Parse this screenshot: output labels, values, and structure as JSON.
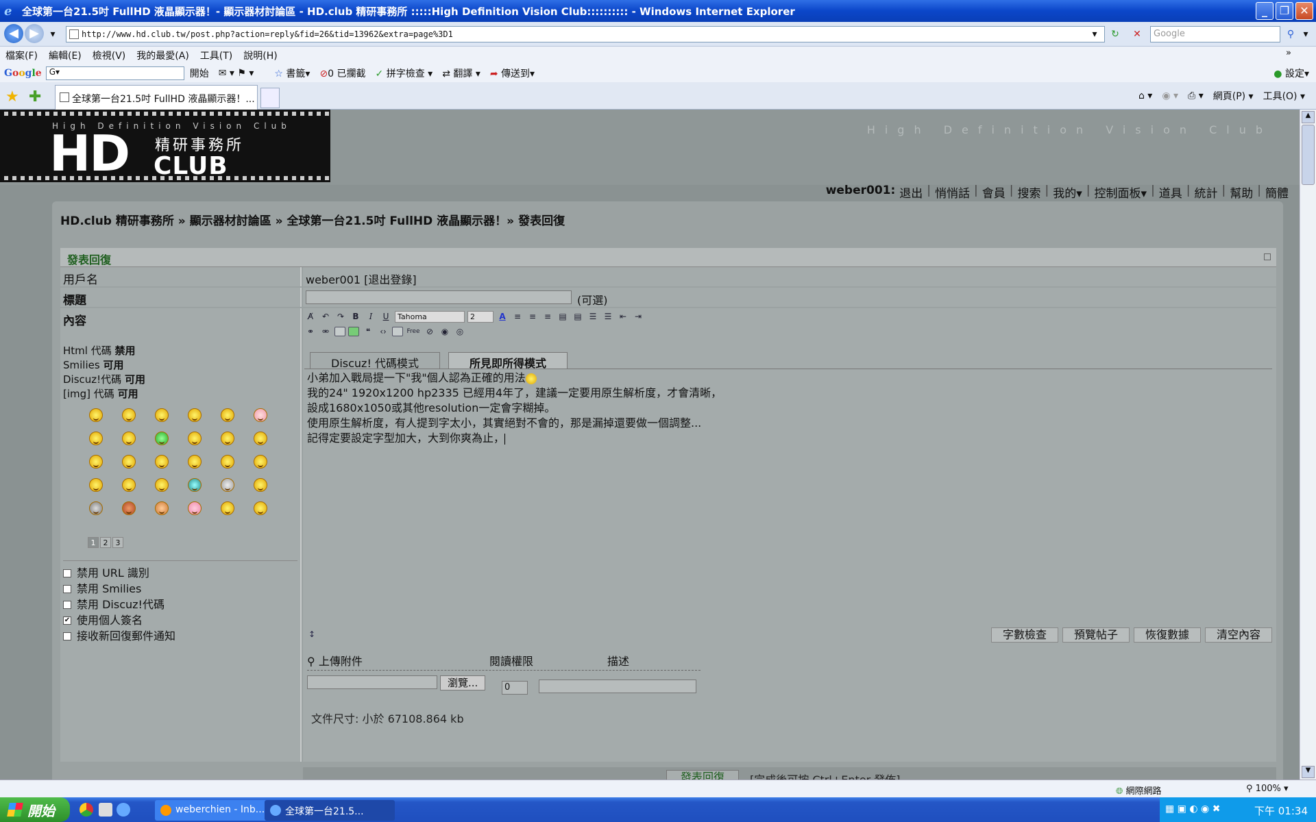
{
  "window": {
    "title": "全球第一台21.5吋 FullHD 液晶顯示器！- 顯示器材討論區 - HD.club 精研事務所 :::::High Definition Vision Club:::::::::: - Windows Internet Explorer"
  },
  "address": {
    "url": "http://www.hd.club.tw/post.php?action=reply&fid=26&tid=13962&extra=page%3D1",
    "search_placeholder": "Google"
  },
  "menu": [
    "檔案(F)",
    "編輯(E)",
    "檢視(V)",
    "我的最愛(A)",
    "工具(T)",
    "說明(H)"
  ],
  "google_toolbar": {
    "search_value": "G▾",
    "items": [
      "開始",
      "書籤▾",
      "0 已攔截",
      "拼字檢查 ▾",
      "翻譯 ▾",
      "傳送到▾"
    ],
    "settings": "設定▾"
  },
  "tabs": {
    "active_label": "全球第一台21.5吋 FullHD 液晶顯示器！..."
  },
  "command_bar": [
    "網頁(P) ▾",
    "工具(O) ▾"
  ],
  "site": {
    "logo_tagline": "High Definition Vision Club",
    "logo_big": "HD",
    "logo_chinese": "精研事務所",
    "logo_club": "CLUB",
    "header_tagline": "High Definition Vision Club"
  },
  "user_nav": {
    "user": "weber001:",
    "links": [
      "退出",
      "悄悄話",
      "會員",
      "搜索",
      "我的▾",
      "控制面板▾",
      "道具",
      "統計",
      "幫助",
      "簡體"
    ]
  },
  "breadcrumb": "HD.club 精研事務所 » 顯示器材討論區 » 全球第一台21.5吋 FullHD 液晶顯示器！» 發表回復",
  "form": {
    "header": "發表回復",
    "username_label": "用戶名",
    "username_value": "weber001 [退出登錄]",
    "title_label": "標題",
    "title_optional": "(可選)",
    "content_label": "內容",
    "codes": [
      {
        "name": "Html 代碼",
        "status": "禁用"
      },
      {
        "name": "Smilies",
        "status": "可用"
      },
      {
        "name": "Discuz!代碼",
        "status": "可用"
      },
      {
        "name": "[img] 代碼",
        "status": "可用"
      }
    ],
    "smiley_pages": [
      "1",
      "2",
      "3"
    ],
    "options": [
      {
        "label": "禁用 URL 識別",
        "checked": false
      },
      {
        "label": "禁用 Smilies",
        "checked": false
      },
      {
        "label": "禁用 Discuz!代碼",
        "checked": false
      },
      {
        "label": "使用個人簽名",
        "checked": true
      },
      {
        "label": "接收新回復郵件通知",
        "checked": false
      }
    ]
  },
  "editor": {
    "font_name": "Tahoma",
    "font_size": "2",
    "tab_code": "Discuz! 代碼模式",
    "tab_wysiwyg": "所見即所得模式",
    "body_lines": [
      "小弟加入戰局提一下\"我\"個人認為正確的用法",
      "我的24\" 1920x1200 hp2335 已經用4年了，建議一定要用原生解析度，才會清晰，",
      "設成1680x1050或其他resolution一定會字糊掉。",
      "使用原生解析度，有人提到字太小，其實絕對不會的，那是漏掉還要做一個調整...",
      "記得定要設定字型加大，大到你爽為止，"
    ],
    "buttons": [
      "字數檢查",
      "預覽帖子",
      "恢復數據",
      "清空內容"
    ]
  },
  "attachment": {
    "upload_label": "上傳附件",
    "permission_label": "閱讀權限",
    "description_label": "描述",
    "browse_label": "瀏覽...",
    "permission_value": "0",
    "size_text": "文件尺寸: 小於 67108.864 kb"
  },
  "submit": {
    "button": "發表回復",
    "hint": "[完成後可按 Ctrl+Enter 發佈]"
  },
  "status_bar": {
    "zone": "網際網路",
    "zoom": "100%"
  },
  "taskbar": {
    "start": "開始",
    "tasks": [
      "weberchien - Inb...",
      "全球第一台21.5..."
    ],
    "clock": "下午 01:34"
  }
}
